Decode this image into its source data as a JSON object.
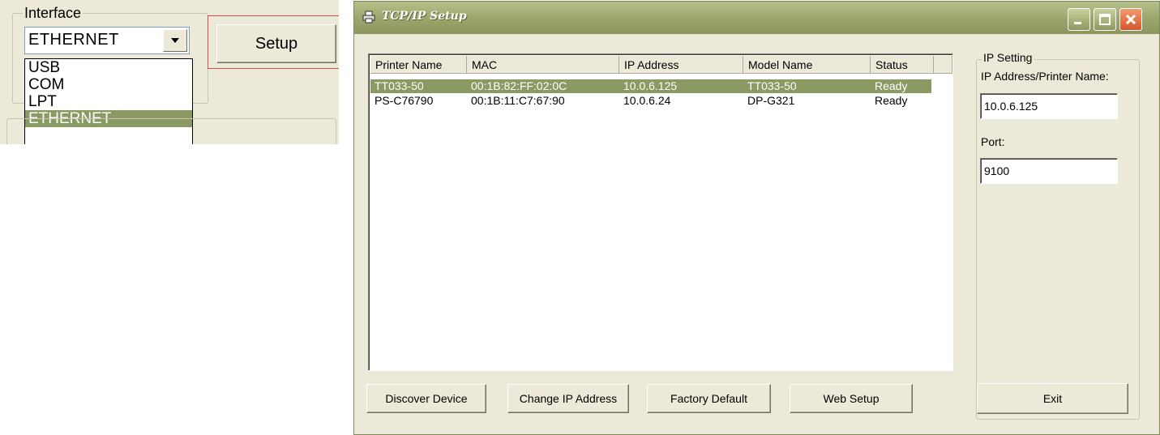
{
  "interface_panel": {
    "legend": "Interface",
    "selected": "ETHERNET",
    "options": [
      "USB",
      "COM",
      "LPT",
      "ETHERNET"
    ],
    "selected_option_index": 3,
    "setup_label": "Setup"
  },
  "dialog": {
    "title": "TCP/IP Setup",
    "columns": [
      "Printer Name",
      "MAC",
      "IP Address",
      "Model Name",
      "Status"
    ],
    "rows": [
      [
        "TT033-50",
        "00:1B:82:FF:02:0C",
        "10.0.6.125",
        "TT033-50",
        "Ready"
      ],
      [
        "PS-C76790",
        "00:1B:11:C7:67:90",
        "10.0.6.24",
        "DP-G321",
        "Ready"
      ]
    ],
    "selected_row_index": 0,
    "buttons": {
      "discover": "Discover Device",
      "change_ip": "Change IP Address",
      "factory_default": "Factory Default",
      "web_setup": "Web Setup",
      "exit": "Exit"
    },
    "ip_setting": {
      "legend": "IP Setting",
      "address_label": "IP Address/Printer Name:",
      "address_value": "10.0.6.125",
      "port_label": "Port:",
      "port_value": "9100"
    }
  },
  "colors": {
    "selection": "#8a9a62",
    "titlebar": "#9aa56c",
    "highlight_box": "#d94b4b"
  }
}
